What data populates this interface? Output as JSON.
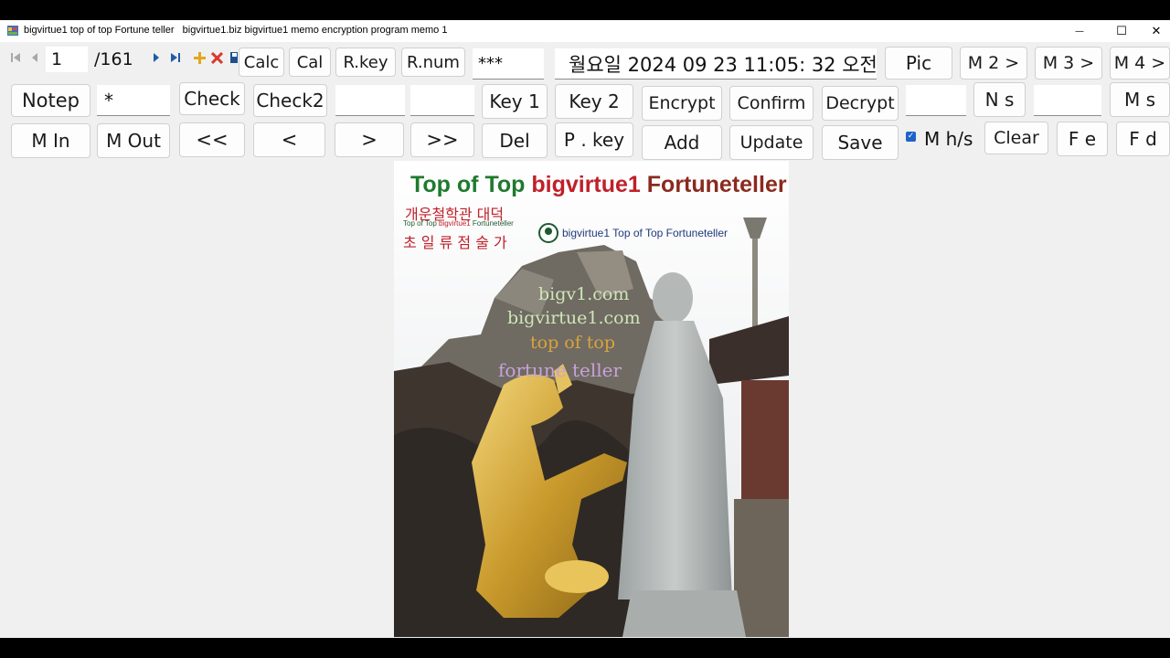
{
  "window": {
    "title": "bigvirtue1 top of top Fortune teller   bigvirtue1.biz bigvirtue1 memo encryption program memo 1",
    "minimize_glyph": "—",
    "maximize_glyph": "☐",
    "close_glyph": "✕"
  },
  "nav": {
    "current": "1",
    "total": "/161",
    "first_icon": "first-icon",
    "prev_icon": "prev-icon",
    "next_icon": "next-icon",
    "last_icon": "last-icon",
    "add_icon": "plus-icon",
    "delete_icon": "delete-icon",
    "save_icon": "floppy-icon"
  },
  "row1": {
    "calc": "Calc",
    "cal": "Cal",
    "rkey": "R.key",
    "rnum": "R.num",
    "password_value": "***",
    "datetime": "월요일 2024 09 23 11:05: 32 오전",
    "pic": "Pic",
    "m2": "M 2 >",
    "m3": "M 3 >",
    "m4": "M 4 >"
  },
  "row2": {
    "notep": "Notep",
    "search_value": "*",
    "check": "Check",
    "check2": "Check2",
    "key1": "Key 1",
    "key2": "Key 2",
    "encrypt": "Encrypt",
    "confirm": "Confirm",
    "decrypt": "Decrypt",
    "ns": "N s",
    "ms": "M s"
  },
  "row3": {
    "min": "M In",
    "mout": "M Out",
    "first": "<<",
    "prev": "<",
    "next": ">",
    "last": ">>",
    "del": "Del",
    "pkey": "P . key",
    "add": "Add",
    "update": "Update",
    "save": "Save",
    "mhs_label": "M h/s",
    "mhs_checked": true,
    "clear": "Clear",
    "fe": "F e",
    "fd": "F d"
  },
  "poster": {
    "heading_part1": "Top of Top ",
    "heading_part2": "bigvirtue1",
    "heading_part3": " Fortuneteller",
    "korean_line1": "개운철학관 대덕",
    "small_line_part1": "Top of Top ",
    "small_line_part2": "bigvirtue1",
    "small_line_part3": " Fortuneteller",
    "korean_line2": "초 일 류 점 술 가",
    "logo_text": "bigvirtue1 Top of Top Fortuneteller",
    "url1": "bigv1.com",
    "url2": "bigvirtue1.com",
    "tag1": "top of top",
    "tag2": "fortune teller",
    "colors": {
      "green": "#1f7a2e",
      "red": "#c0202a",
      "gold": "#d9a43b",
      "lavender": "#c8a2d8",
      "pale_green": "#cfe7b8"
    }
  }
}
